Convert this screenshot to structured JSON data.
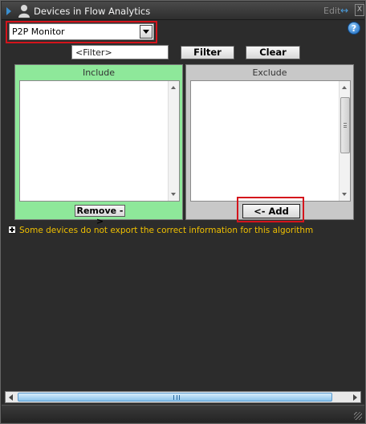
{
  "window": {
    "title": "Devices in Flow Analytics",
    "edit_label": "Edit",
    "swap_glyph": "↔",
    "close_glyph": "X",
    "help_glyph": "?"
  },
  "monitor_select": {
    "value": "P2P Monitor"
  },
  "filter": {
    "placeholder": "<Filter>",
    "filter_button": "Filter",
    "clear_button": "Clear"
  },
  "include_panel": {
    "header": "Include",
    "items": [],
    "remove_button": "Remove ->"
  },
  "exclude_panel": {
    "header": "Exclude",
    "items": [],
    "add_button": "<- Add"
  },
  "note": {
    "text": "Some devices do not export the correct information for this algorithm"
  },
  "colors": {
    "include_bg": "#8ee89a",
    "exclude_bg": "#c8c8c8",
    "note_text": "#f0c000",
    "highlight": "#d4141c",
    "accent": "#3a8fd0"
  }
}
